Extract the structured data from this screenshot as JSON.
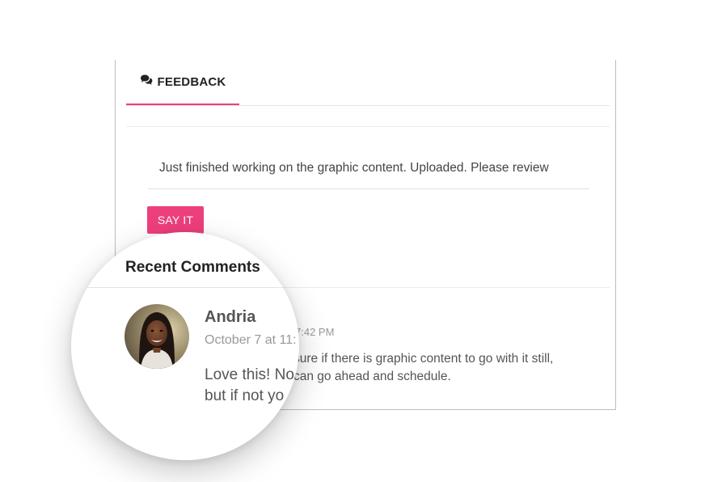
{
  "feedback_tab": {
    "label": "FEEDBACK",
    "icon": "comments-icon",
    "accent_color": "#ee3f7d"
  },
  "message": {
    "text": "Just finished working on the graphic content. Uploaded. Please review"
  },
  "submit_button": {
    "label": "SAY IT",
    "color": "#ee3f7d"
  },
  "comments": {
    "title": "Recent Comments",
    "items": [
      {
        "author": "Andria",
        "date_zoomed": "October 7 at 11:",
        "date_behind": "7:42 PM",
        "text_zoomed_line1": "Love this! No",
        "text_zoomed_line2": "but if not yo",
        "text_behind_line1": "sure if there is graphic content to go with it still,",
        "text_behind_line2": "can go ahead and schedule."
      }
    ]
  }
}
